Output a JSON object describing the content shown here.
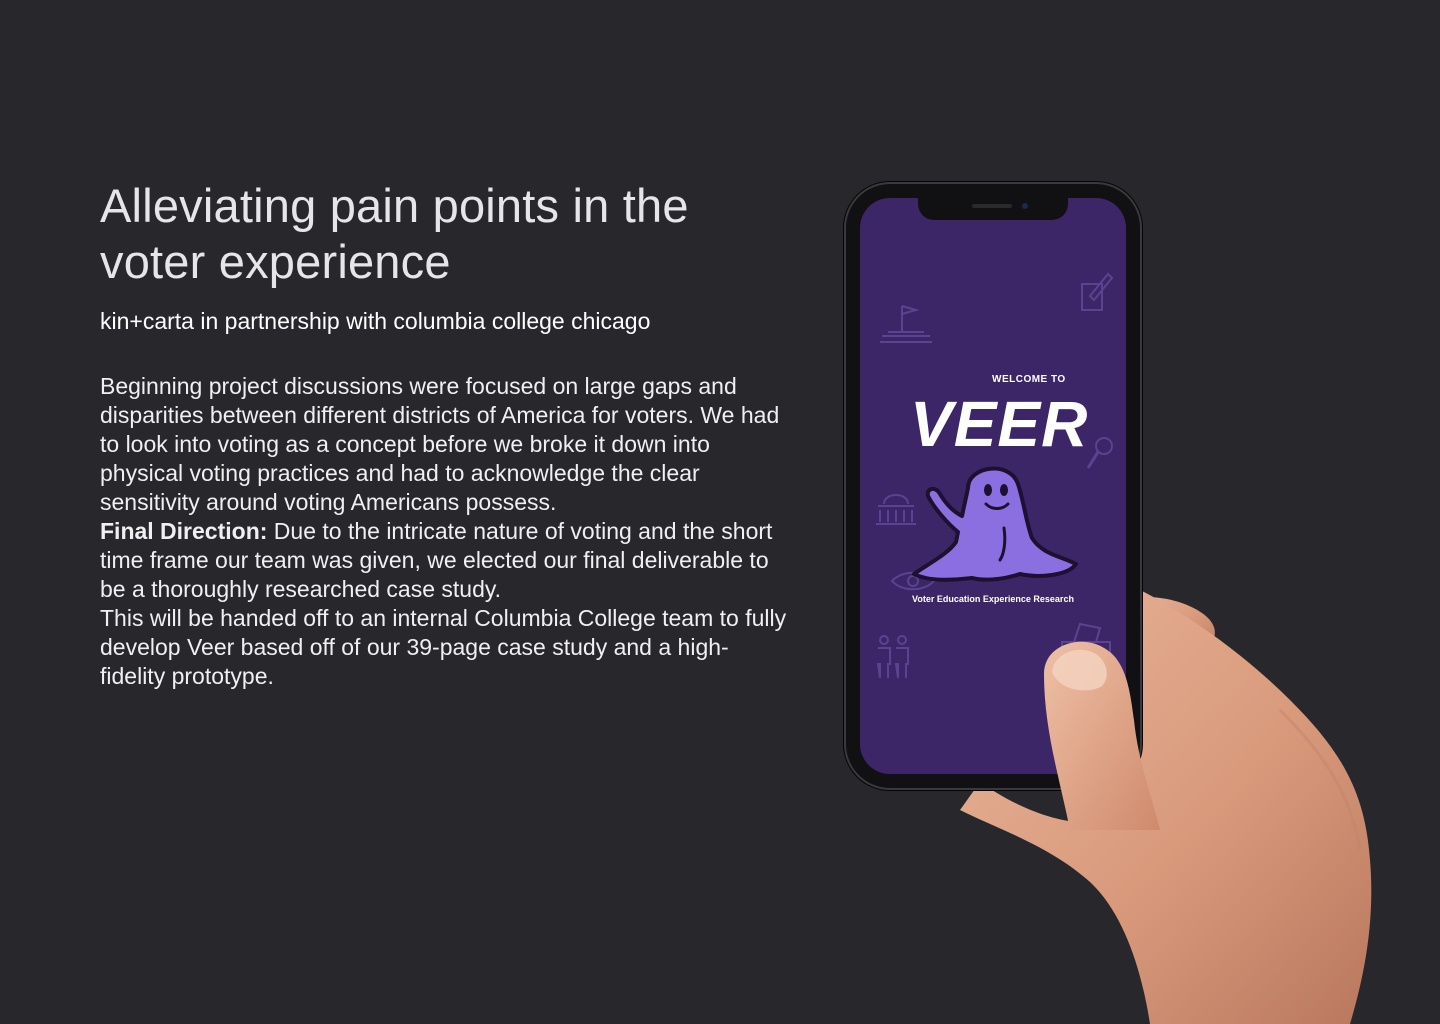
{
  "header": {
    "title": "Alleviating pain points in the voter experience",
    "subtitle": "kin+carta in partnership with columbia college chicago"
  },
  "body": {
    "intro": "Beginning project discussions were focused on large gaps and disparities between different districts of America for voters. We had to look into voting as a concept before we broke it down into physical voting practices and had to acknowledge the clear sensitivity around voting Americans possess.",
    "final_direction_label": "Final Direction:",
    "final_direction_text": " Due to the intricate nature of voting and the short time frame our team was given, we elected our final deliverable to be a thoroughly researched case study.",
    "handoff": "This will be handed off to an internal Columbia College team to fully develop Veer based off of our 39-page case study and a high-fidelity prototype."
  },
  "app_screen": {
    "welcome": "WELCOME TO",
    "app_name": "VEER",
    "tagline": "Voter Education Experience Research",
    "screen_color": "#3d2667",
    "ghost_color": "#8b6fe0"
  },
  "colors": {
    "background": "#27272c",
    "title": "#e6e6e8",
    "text": "#ffffff"
  }
}
